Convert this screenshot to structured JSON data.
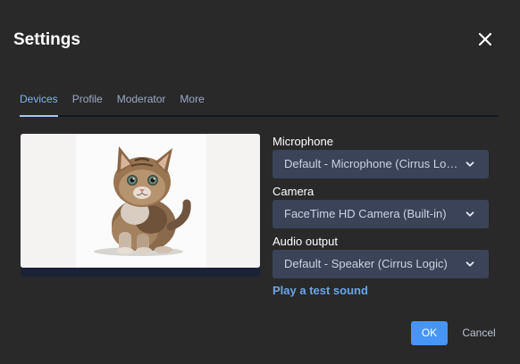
{
  "dialog": {
    "title": "Settings",
    "close_icon": "close-icon"
  },
  "tabs": [
    {
      "label": "Devices",
      "active": true
    },
    {
      "label": "Profile",
      "active": false
    },
    {
      "label": "Moderator",
      "active": false
    },
    {
      "label": "More",
      "active": false
    }
  ],
  "devices": {
    "microphone": {
      "label": "Microphone",
      "value": "Default - Microphone (Cirrus Logic)"
    },
    "camera": {
      "label": "Camera",
      "value": "FaceTime HD Camera (Built-in)"
    },
    "audio_output": {
      "label": "Audio output",
      "value": "Default - Speaker (Cirrus Logic)"
    },
    "test_sound": "Play a test sound"
  },
  "footer": {
    "ok_label": "OK",
    "cancel_label": "Cancel"
  },
  "colors": {
    "background": "#292929",
    "select_bg": "#3a4358",
    "accent": "#4796f5",
    "link": "#6aa6ea"
  }
}
